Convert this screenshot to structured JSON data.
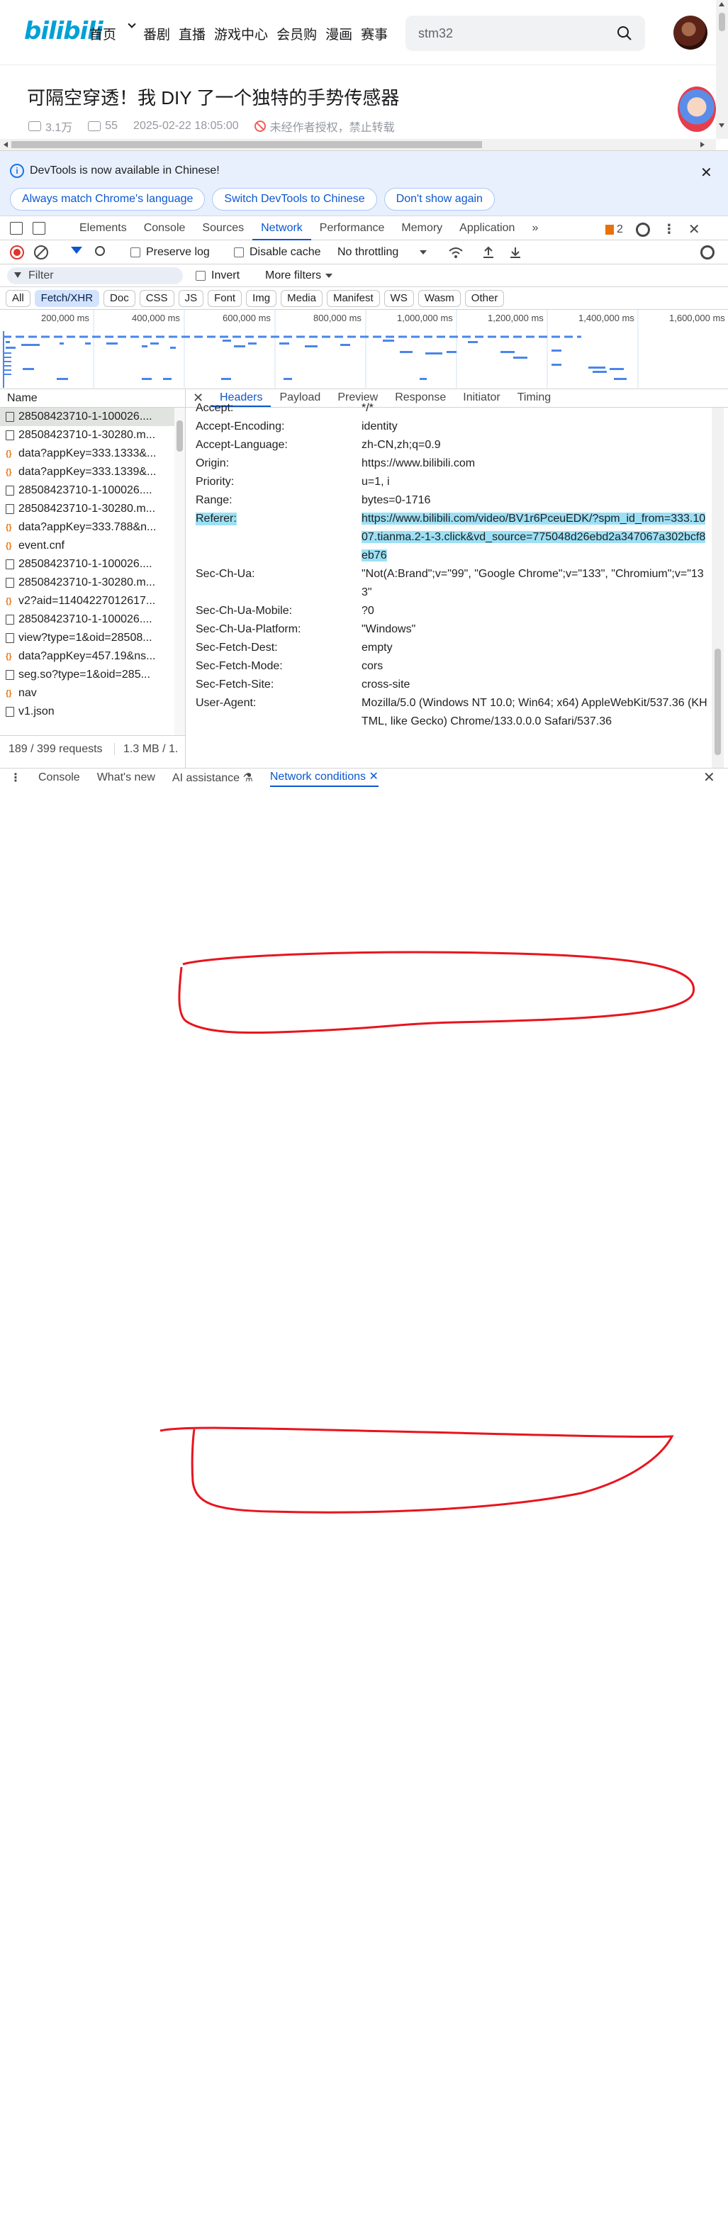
{
  "bili": {
    "logo": "bilibili",
    "nav": [
      "首页",
      "番剧",
      "直播",
      "游戏中心",
      "会员购",
      "漫画",
      "赛事"
    ],
    "search_text": "stm32",
    "video_title": "可隔空穿透！我 DIY 了一个独特的手势传感器",
    "views": "3.1万",
    "comments": "55",
    "date": "2025-02-22 18:05:00",
    "notice": "未经作者授权，禁止转载"
  },
  "devtools": {
    "infobar": {
      "message": "DevTools is now available in Chinese!",
      "btn_match": "Always match Chrome's language",
      "btn_switch": "Switch DevTools to Chinese",
      "btn_dont": "Don't show again"
    },
    "tabs": [
      "Elements",
      "Console",
      "Sources",
      "Network",
      "Performance",
      "Memory",
      "Application"
    ],
    "active_tab": "Network",
    "more_tabs": "»",
    "issues_count": "2",
    "toolbar": {
      "preserve_log": "Preserve log",
      "disable_cache": "Disable cache",
      "throttling": "No throttling"
    },
    "filter": {
      "placeholder": "Filter",
      "invert": "Invert",
      "more_filters": "More filters"
    },
    "type_filters": [
      "All",
      "Fetch/XHR",
      "Doc",
      "CSS",
      "JS",
      "Font",
      "Img",
      "Media",
      "Manifest",
      "WS",
      "Wasm",
      "Other"
    ],
    "active_filter": "Fetch/XHR",
    "timeline_ticks": [
      "200,000 ms",
      "400,000 ms",
      "600,000 ms",
      "800,000 ms",
      "1,000,000 ms",
      "1,200,000 ms",
      "1,400,000 ms",
      "1,600,000 ms"
    ],
    "request_list": {
      "header": "Name",
      "rows": [
        {
          "name": "28508423710-1-100026....",
          "type": "doc",
          "selected": true
        },
        {
          "name": "28508423710-1-30280.m...",
          "type": "doc"
        },
        {
          "name": "data?appKey=333.1333&...",
          "type": "xhr"
        },
        {
          "name": "data?appKey=333.1339&...",
          "type": "xhr"
        },
        {
          "name": "28508423710-1-100026....",
          "type": "doc"
        },
        {
          "name": "28508423710-1-30280.m...",
          "type": "doc"
        },
        {
          "name": "data?appKey=333.788&n...",
          "type": "xhr"
        },
        {
          "name": "event.cnf",
          "type": "xhr"
        },
        {
          "name": "28508423710-1-100026....",
          "type": "doc"
        },
        {
          "name": "28508423710-1-30280.m...",
          "type": "doc"
        },
        {
          "name": "v2?aid=11404227012617...",
          "type": "xhr"
        },
        {
          "name": "28508423710-1-100026....",
          "type": "doc"
        },
        {
          "name": "view?type=1&oid=28508...",
          "type": "doc"
        },
        {
          "name": "data?appKey=457.19&ns...",
          "type": "xhr"
        },
        {
          "name": "seg.so?type=1&oid=285...",
          "type": "doc"
        },
        {
          "name": "nav",
          "type": "xhr"
        },
        {
          "name": "v1.json",
          "type": "doc"
        }
      ],
      "status": "189 / 399 requests",
      "transfer": "1.3 MB / 1."
    },
    "detail_tabs": [
      "Headers",
      "Payload",
      "Preview",
      "Response",
      "Initiator",
      "Timing"
    ],
    "active_detail_tab": "Headers",
    "headers": [
      {
        "k": "Accept:",
        "v": "*/*"
      },
      {
        "k": "Accept-Encoding:",
        "v": "identity"
      },
      {
        "k": "Accept-Language:",
        "v": "zh-CN,zh;q=0.9"
      },
      {
        "k": "Origin:",
        "v": "https://www.bilibili.com"
      },
      {
        "k": "Priority:",
        "v": "u=1, i"
      },
      {
        "k": "Range:",
        "v": "bytes=0-1716"
      },
      {
        "k": "Referer:",
        "v": "https://www.bilibili.com/video/BV1r6PceuEDK/?spm_id_from=333.1007.tianma.2-1-3.click&vd_source=775048d26ebd2a347067a302bcf8eb76",
        "highlight": true,
        "lines": 3
      },
      {
        "k": "Sec-Ch-Ua:",
        "v": "\"Not(A:Brand\";v=\"99\", \"Google Chrome\";v=\"133\", \"Chromium\";v=\"133\"",
        "lines": 2
      },
      {
        "k": "Sec-Ch-Ua-Mobile:",
        "v": "?0"
      },
      {
        "k": "Sec-Ch-Ua-Platform:",
        "v": "\"Windows\""
      },
      {
        "k": "Sec-Fetch-Dest:",
        "v": "empty"
      },
      {
        "k": "Sec-Fetch-Mode:",
        "v": "cors"
      },
      {
        "k": "Sec-Fetch-Site:",
        "v": "cross-site"
      },
      {
        "k": "User-Agent:",
        "v": "Mozilla/5.0 (Windows NT 10.0; Win64; x64) AppleWebKit/537.36 (KHTML, like Gecko) Chrome/133.0.0.0 Safari/537.36",
        "lines": 3
      }
    ],
    "drawer_tabs": [
      "Console",
      "What's new",
      "AI assistance",
      "Network conditions"
    ],
    "active_drawer_tab": "Network conditions"
  },
  "colors": {
    "accent": "#0b57d0",
    "bili_blue": "#00a1d6",
    "highlight": "#9de0f5",
    "annotation": "#e8141e"
  }
}
